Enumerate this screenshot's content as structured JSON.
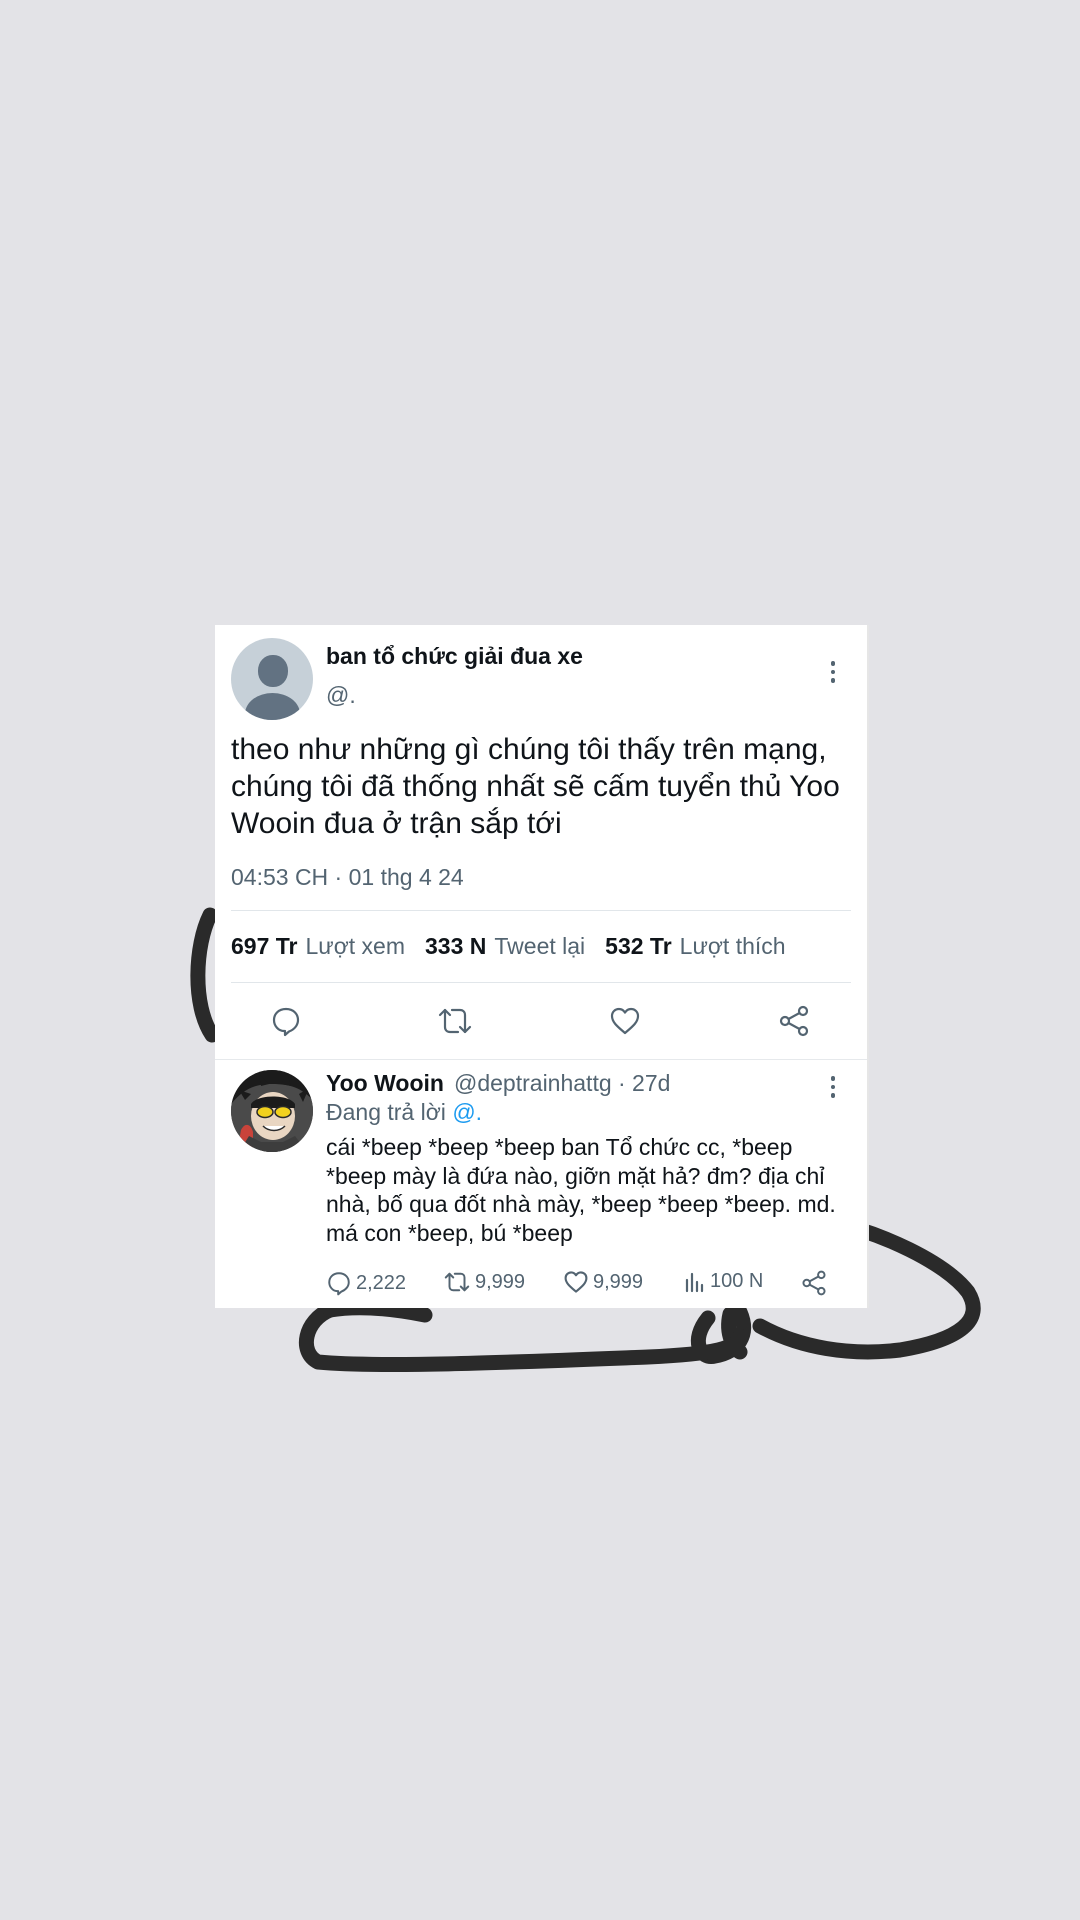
{
  "tweet": {
    "display_name": "ban tổ chức giải đua xe",
    "handle": "@.",
    "text": "theo như những gì chúng tôi thấy trên mạng, chúng tôi đã thống nhất sẽ cấm tuyển thủ Yoo Wooin đua ở trận sắp tới",
    "timestamp": "04:53 CH · 01 thg 4 24",
    "stats": {
      "views_count": "697 Tr",
      "views_label": "Lượt xem",
      "retweets_count": "333 N",
      "retweets_label": "Tweet lại",
      "likes_count": "532 Tr",
      "likes_label": "Lượt thích"
    },
    "actions": [
      "reply-icon",
      "retweet-icon",
      "like-icon",
      "share-icon"
    ]
  },
  "reply": {
    "display_name": "Yoo Wooin",
    "meta": "@deptrainhattg · 27d",
    "replying_prefix": "Đang trả lời",
    "replying_mention": "@.",
    "text": "cái *beep *beep *beep ban Tổ chức cc, *beep *beep mày là đứa nào, giỡn mặt hả? đm? địa chỉ nhà, bố qua đốt nhà mày, *beep *beep *beep. md. má con *beep, bú *beep",
    "counts": {
      "replies": "2,222",
      "retweets": "9,999",
      "likes": "9,999",
      "views": "100 N"
    }
  },
  "colors": {
    "background": "#e3e3e7",
    "card": "#ffffff",
    "text_primary": "#0f1419",
    "text_secondary": "#536471",
    "mention": "#1d9bf0"
  }
}
